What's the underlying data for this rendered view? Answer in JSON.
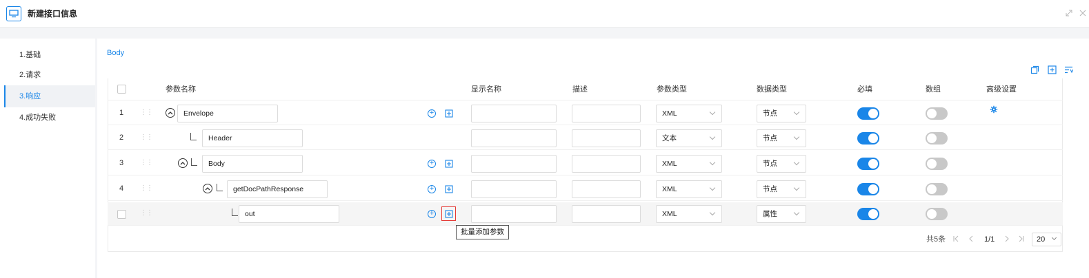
{
  "header": {
    "title": "新建接口信息",
    "icons": [
      "monitor-icon",
      "expand-icon",
      "close-icon"
    ]
  },
  "sidebar": {
    "items": [
      {
        "label": "1.基础",
        "active": false
      },
      {
        "label": "2.请求",
        "active": false
      },
      {
        "label": "3.响应",
        "active": true
      },
      {
        "label": "4.成功失败",
        "active": false
      }
    ]
  },
  "section": {
    "title": "Body",
    "tools": [
      "copy-icon",
      "add-square-icon",
      "filter-list-icon"
    ]
  },
  "table": {
    "columns": {
      "name": "参数名称",
      "display_name": "显示名称",
      "description": "描述",
      "param_type": "参数类型",
      "data_type": "数据类型",
      "required": "必填",
      "array": "数组",
      "advanced": "高级设置"
    },
    "rows": [
      {
        "index": "1",
        "depth": 0,
        "collapsible": true,
        "name": "Envelope",
        "param_type": "XML",
        "data_type": "节点",
        "required": true,
        "array": false,
        "has_actions": true,
        "has_gear": true
      },
      {
        "index": "2",
        "depth": 1,
        "collapsible": false,
        "name": "Header",
        "param_type": "文本",
        "data_type": "节点",
        "required": true,
        "array": false,
        "has_actions": false,
        "has_gear": false
      },
      {
        "index": "3",
        "depth": 1,
        "collapsible": true,
        "name": "Body",
        "param_type": "XML",
        "data_type": "节点",
        "required": true,
        "array": false,
        "has_actions": true,
        "has_gear": false
      },
      {
        "index": "4",
        "depth": 2,
        "collapsible": true,
        "name": "getDocPathResponse",
        "param_type": "XML",
        "data_type": "节点",
        "required": true,
        "array": false,
        "has_actions": true,
        "has_gear": false
      },
      {
        "index": "",
        "depth": 3,
        "collapsible": false,
        "name": "out",
        "param_type": "XML",
        "data_type": "属性",
        "required": true,
        "array": false,
        "has_actions": true,
        "has_gear": false,
        "checkbox": true
      }
    ]
  },
  "tooltip": {
    "text": "批量添加参数"
  },
  "pagination": {
    "total": "共5条",
    "first": "|<",
    "prev": "<",
    "current": "1/1",
    "next": ">",
    "last": ">|",
    "page_size": "20"
  },
  "colors": {
    "accent": "#1a86e8",
    "toggle_off": "#c8c8c8",
    "highlight_border": "#e53935"
  }
}
